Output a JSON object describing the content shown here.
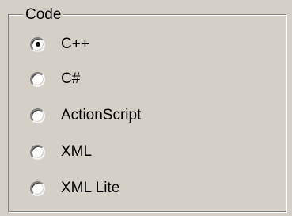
{
  "group": {
    "title": "Code"
  },
  "options": [
    {
      "label": "C++",
      "checked": true
    },
    {
      "label": "C#",
      "checked": false
    },
    {
      "label": "ActionScript",
      "checked": false
    },
    {
      "label": "XML",
      "checked": false
    },
    {
      "label": "XML Lite",
      "checked": false
    }
  ]
}
